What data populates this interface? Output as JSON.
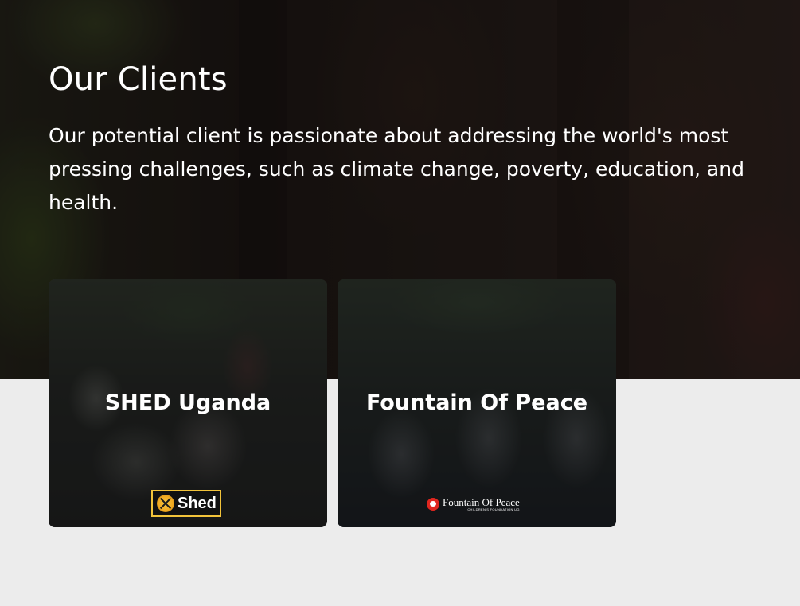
{
  "section": {
    "title": "Our Clients",
    "description": "Our potential client is passionate about addressing the world's most pressing challenges, such as climate change, poverty, education, and health."
  },
  "clients": [
    {
      "name": "SHED Uganda",
      "logo_text": "Shed",
      "logo_icon": "shed-logo-icon",
      "logo_accent": "#f2c33a"
    },
    {
      "name": "Fountain Of Peace",
      "logo_text": "Fountain Of Peace",
      "logo_subtext": "CHILDREN'S FOUNDATION UG",
      "logo_icon": "fountain-of-peace-logo-icon",
      "logo_accent": "#e0261f"
    }
  ],
  "colors": {
    "page_background": "#ececec",
    "text_light": "#ffffff"
  }
}
